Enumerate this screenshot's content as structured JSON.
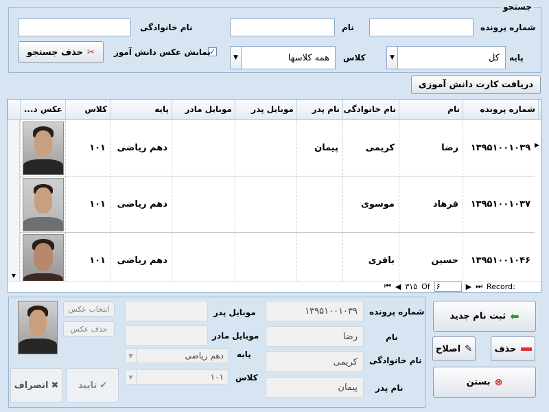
{
  "search": {
    "legend": "جستجو",
    "file_no_label": "شماره پرونده",
    "first_name_label": "نام",
    "last_name_label": "نام خانوادگی",
    "grade_label": "پایه",
    "grade_value": "کل",
    "class_label": "کلاس",
    "class_value": "همه کلاسها",
    "show_photo_label": "نمایش عکس دانش آموز",
    "clear_button": "حذف جستجو"
  },
  "card_button": "دریافت کارت دانش آموزی",
  "grid": {
    "columns": [
      "شماره پرونده",
      "نام",
      "نام خانوادگی",
      "نام پدر",
      "موبایل پدر",
      "موبایل مادر",
      "پایه",
      "کلاس",
      "عکس د..."
    ],
    "rows": [
      {
        "file_no": "۱۳۹۵۱۰۰۱۰۳۹",
        "first": "رضا",
        "last": "کریمی",
        "father": "پیمان",
        "father_mobile": "",
        "mother_mobile": "",
        "grade": "دهم ریاضی",
        "class": "۱۰۱"
      },
      {
        "file_no": "۱۳۹۵۱۰۰۱۰۳۷",
        "first": "فرهاد",
        "last": "موسوی",
        "father": "",
        "father_mobile": "",
        "mother_mobile": "",
        "grade": "دهم ریاضی",
        "class": "۱۰۱"
      },
      {
        "file_no": "۱۳۹۵۱۰۰۱۰۴۶",
        "first": "حسین",
        "last": "باقری",
        "father": "",
        "father_mobile": "",
        "mother_mobile": "",
        "grade": "دهم ریاضی",
        "class": "۱۰۱"
      }
    ],
    "nav_record_label": "Record:",
    "nav_current": "۶",
    "nav_of": "Of",
    "nav_total": "۳۱۵"
  },
  "detail": {
    "file_no_label": "شماره پرونده",
    "file_no_value": "۱۳۹۵۱۰۰۱۰۳۹",
    "first_label": "نام",
    "first_value": "رضا",
    "last_label": "نام خانوادگی",
    "last_value": "کریمی",
    "father_label": "نام پدر",
    "father_value": "پیمان",
    "father_mobile_label": "موبایل پدر",
    "mother_mobile_label": "موبایل مادر",
    "grade_label": "پایه",
    "grade_value": "دهم ریاضی",
    "class_label": "کلاس",
    "class_value": "۱۰۱",
    "choose_photo": "انتخاب عکس",
    "delete_photo": "حذف عکس",
    "confirm": "تایید",
    "cancel": "انصراف"
  },
  "actions": {
    "new": "ثبت نام جدید",
    "edit": "اصلاح",
    "delete": "حذف",
    "close": "بستن"
  }
}
